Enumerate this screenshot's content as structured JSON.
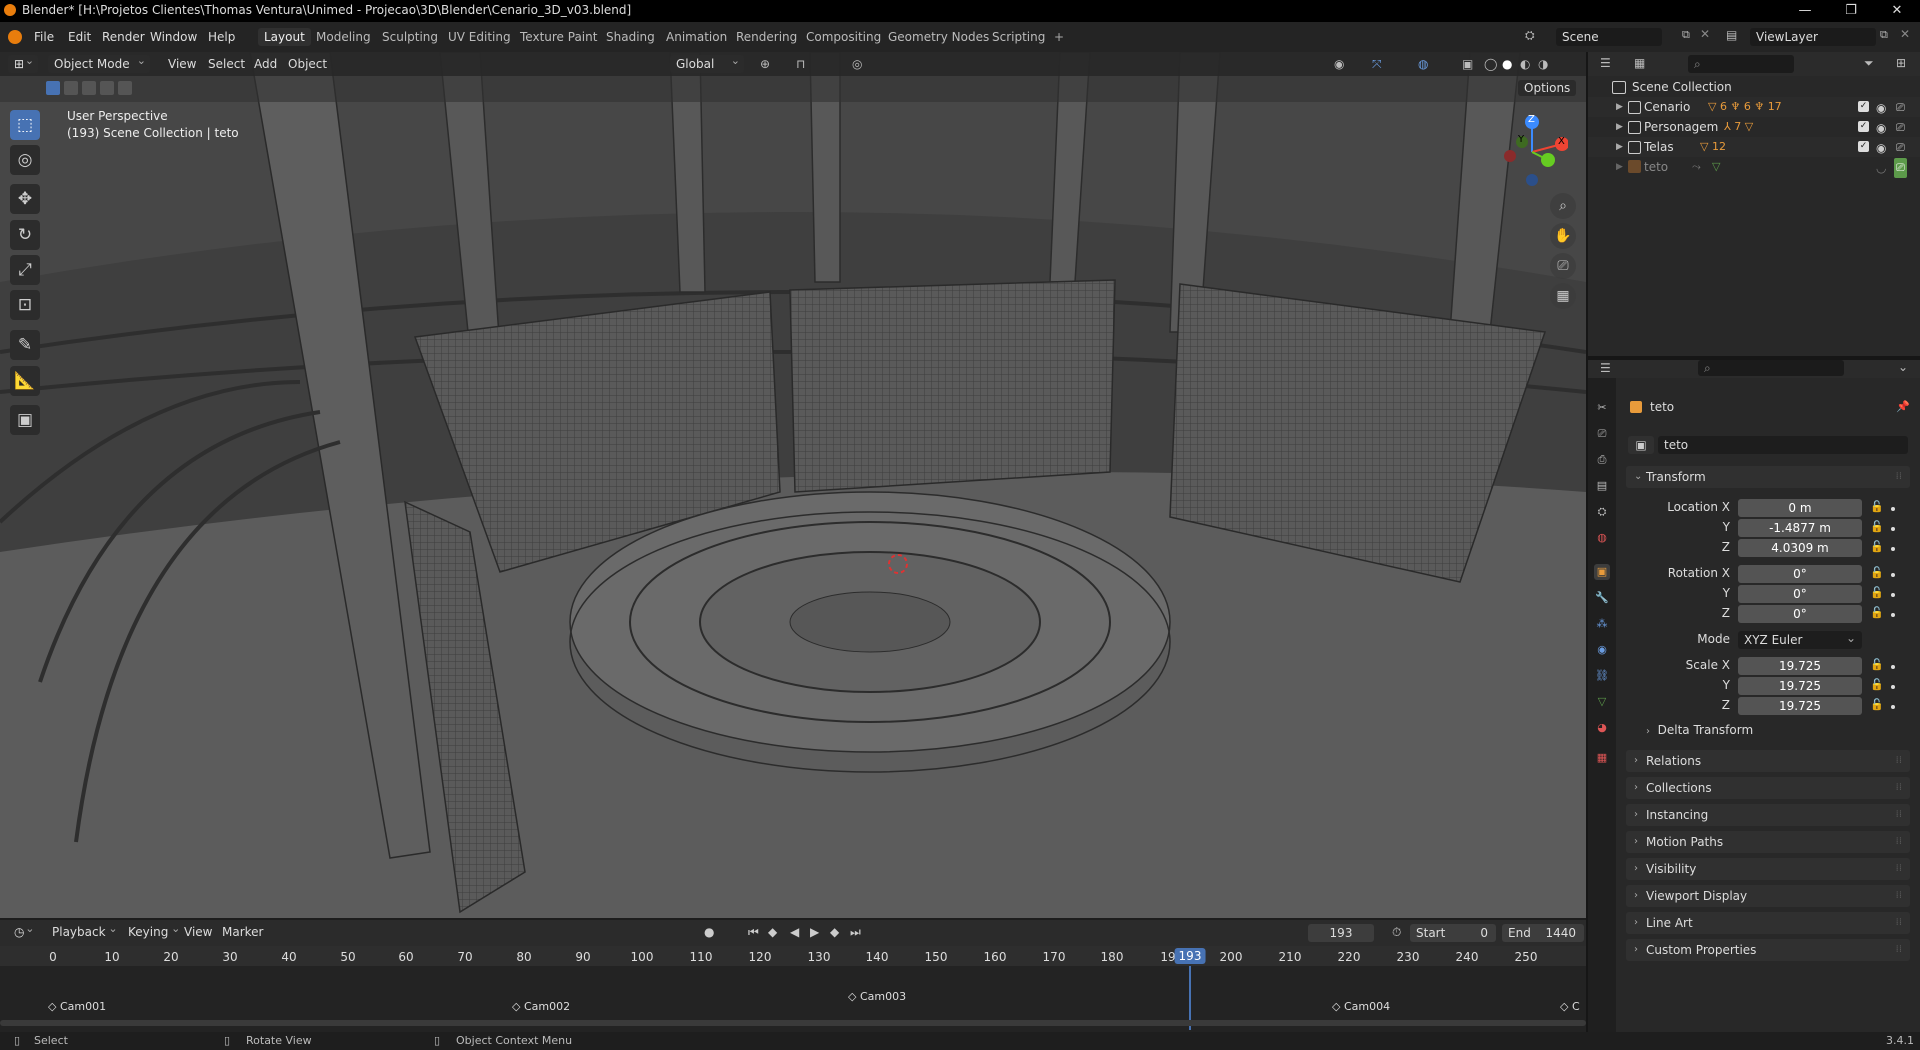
{
  "window": {
    "title": "Blender* [H:\\Projetos Clientes\\Thomas Ventura\\Unimed - Projecao\\3D\\Blender\\Cenario_3D_v03.blend]",
    "controls": [
      "—",
      "❐",
      "✕"
    ]
  },
  "menu": [
    "File",
    "Edit",
    "Render",
    "Window",
    "Help"
  ],
  "workspaces": [
    "Layout",
    "Modeling",
    "Sculpting",
    "UV Editing",
    "Texture Paint",
    "Shading",
    "Animation",
    "Rendering",
    "Compositing",
    "Geometry Nodes",
    "Scripting"
  ],
  "active_workspace": "Layout",
  "scene": {
    "name": "Scene",
    "view_layer": "ViewLayer"
  },
  "viewport": {
    "mode": "Object Mode",
    "menus": [
      "View",
      "Select",
      "Add",
      "Object"
    ],
    "orientation": "Global",
    "options_label": "Options",
    "perspective": "User Perspective",
    "collection_info": "(193) Scene Collection | teto",
    "axes": {
      "x": "X",
      "y": "Y",
      "z": "Z"
    }
  },
  "outliner": {
    "root": "Scene Collection",
    "items": [
      {
        "name": "Cenario",
        "counts": [
          "6",
          "6",
          "17"
        ]
      },
      {
        "name": "Personagem",
        "counts": [
          "7"
        ]
      },
      {
        "name": "Telas",
        "counts": [
          "12"
        ]
      },
      {
        "name": "teto",
        "counts": []
      }
    ]
  },
  "properties": {
    "object_name": "teto",
    "data_name": "teto",
    "transform_label": "Transform",
    "location": {
      "label_x": "Location X",
      "x": "0 m",
      "y": "-1.4877 m",
      "z": "4.0309 m"
    },
    "rotation": {
      "label_x": "Rotation X",
      "x": "0°",
      "y": "0°",
      "z": "0°"
    },
    "mode_label": "Mode",
    "mode": "XYZ Euler",
    "scale": {
      "label_x": "Scale X",
      "x": "19.725",
      "y": "19.725",
      "z": "19.725"
    },
    "y_label": "Y",
    "z_label": "Z",
    "delta": "Delta Transform",
    "panels": [
      "Relations",
      "Collections",
      "Instancing",
      "Motion Paths",
      "Visibility",
      "Viewport Display",
      "Line Art",
      "Custom Properties"
    ]
  },
  "timeline": {
    "menus": [
      "Playback",
      "Keying",
      "View",
      "Marker"
    ],
    "current_frame": "193",
    "start_label": "Start",
    "start": "0",
    "end_label": "End",
    "end": "1440",
    "ticks": [
      "0",
      "10",
      "20",
      "30",
      "40",
      "50",
      "60",
      "70",
      "80",
      "90",
      "100",
      "110",
      "120",
      "130",
      "140",
      "150",
      "160",
      "170",
      "180",
      "19",
      "193",
      "200",
      "210",
      "220",
      "230",
      "240",
      "250"
    ],
    "markers": [
      "Cam001",
      "Cam002",
      "Cam003",
      "Cam004",
      "C"
    ]
  },
  "status": {
    "select": "Select",
    "rotate": "Rotate View",
    "context": "Object Context Menu",
    "version": "3.4.1"
  },
  "colors": {
    "accent": "#4772b3",
    "logo": "#e87d0d"
  }
}
